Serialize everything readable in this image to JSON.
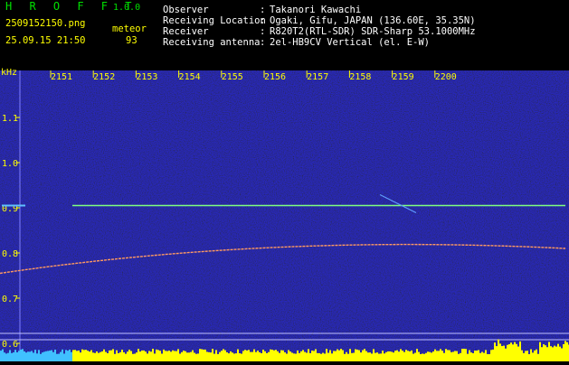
{
  "app": {
    "brand": "H R O F F T",
    "version": "1.0.0"
  },
  "file": {
    "name": "2509152150.png",
    "datetime": "25.09.15 21:50"
  },
  "detection": {
    "mode": "meteor",
    "count": "93"
  },
  "info": [
    {
      "label": "Observer",
      "value": "Takanori Kawachi"
    },
    {
      "label": "Receiving Location",
      "value": "Ogaki, Gifu, JAPAN (136.60E, 35.35N)"
    },
    {
      "label": "Receiver",
      "value": "R820T2(RTL-SDR) SDR-Sharp 53.1000MHz"
    },
    {
      "label": "Receiving antenna",
      "value": "2el-HB9CV Vertical (el. E-W)"
    }
  ],
  "axis": {
    "unit": "kHz",
    "time_labels": [
      "2151",
      "2152",
      "2153",
      "2154",
      "2155",
      "2156",
      "2157",
      "2158",
      "2159",
      "2200"
    ],
    "freq_labels": [
      "1.1",
      "1.0",
      "0.9",
      "0.8",
      "0.7",
      "0.6"
    ]
  },
  "signals": {
    "carrier_khz": 0.905,
    "drift_start_khz": 0.755,
    "drift_end_khz": 0.81
  },
  "colors": {
    "background": "#000000",
    "spectrogram": "#0c0c8a",
    "header_green": "#00e000",
    "header_yellow": "#ffff00",
    "signal": "#7fff7f",
    "level_bars": "#ffff00"
  }
}
